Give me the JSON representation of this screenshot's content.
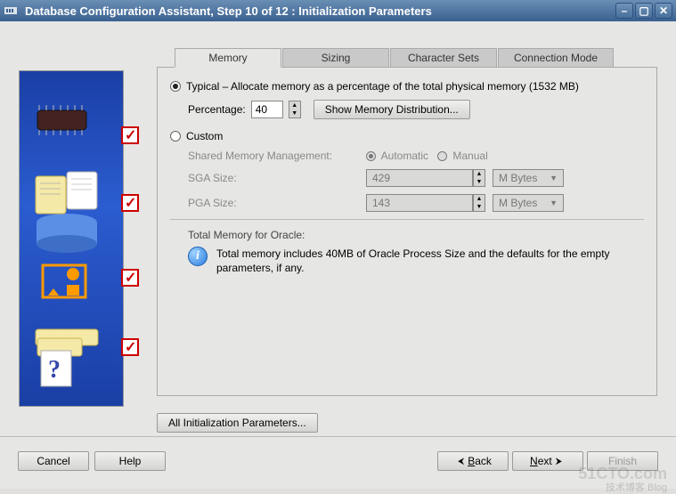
{
  "window": {
    "title": "Database Configuration Assistant, Step 10 of 12 : Initialization Parameters"
  },
  "tabs": {
    "memory": "Memory",
    "sizing": "Sizing",
    "charsets": "Character Sets",
    "connection": "Connection Mode"
  },
  "memory": {
    "typical_label": "Typical – Allocate memory as a percentage of the total physical memory (1532 MB)",
    "percentage_label": "Percentage:",
    "percentage_value": "40",
    "show_dist_btn": "Show Memory Distribution...",
    "custom_label": "Custom",
    "smm_label": "Shared Memory Management:",
    "smm_auto": "Automatic",
    "smm_manual": "Manual",
    "sga_label": "SGA Size:",
    "sga_value": "429",
    "pga_label": "PGA Size:",
    "pga_value": "143",
    "unit": "M Bytes",
    "total_label": "Total Memory for Oracle:",
    "info_text": "Total memory includes 40MB of Oracle Process Size and the defaults for the empty parameters, if any."
  },
  "all_params_btn": "All Initialization Parameters...",
  "footer": {
    "cancel": "Cancel",
    "help": "Help",
    "back": "Back",
    "next": "Next",
    "finish": "Finish"
  },
  "watermark": "51CTO.com",
  "watermark_sub": "技术博客 Blog"
}
